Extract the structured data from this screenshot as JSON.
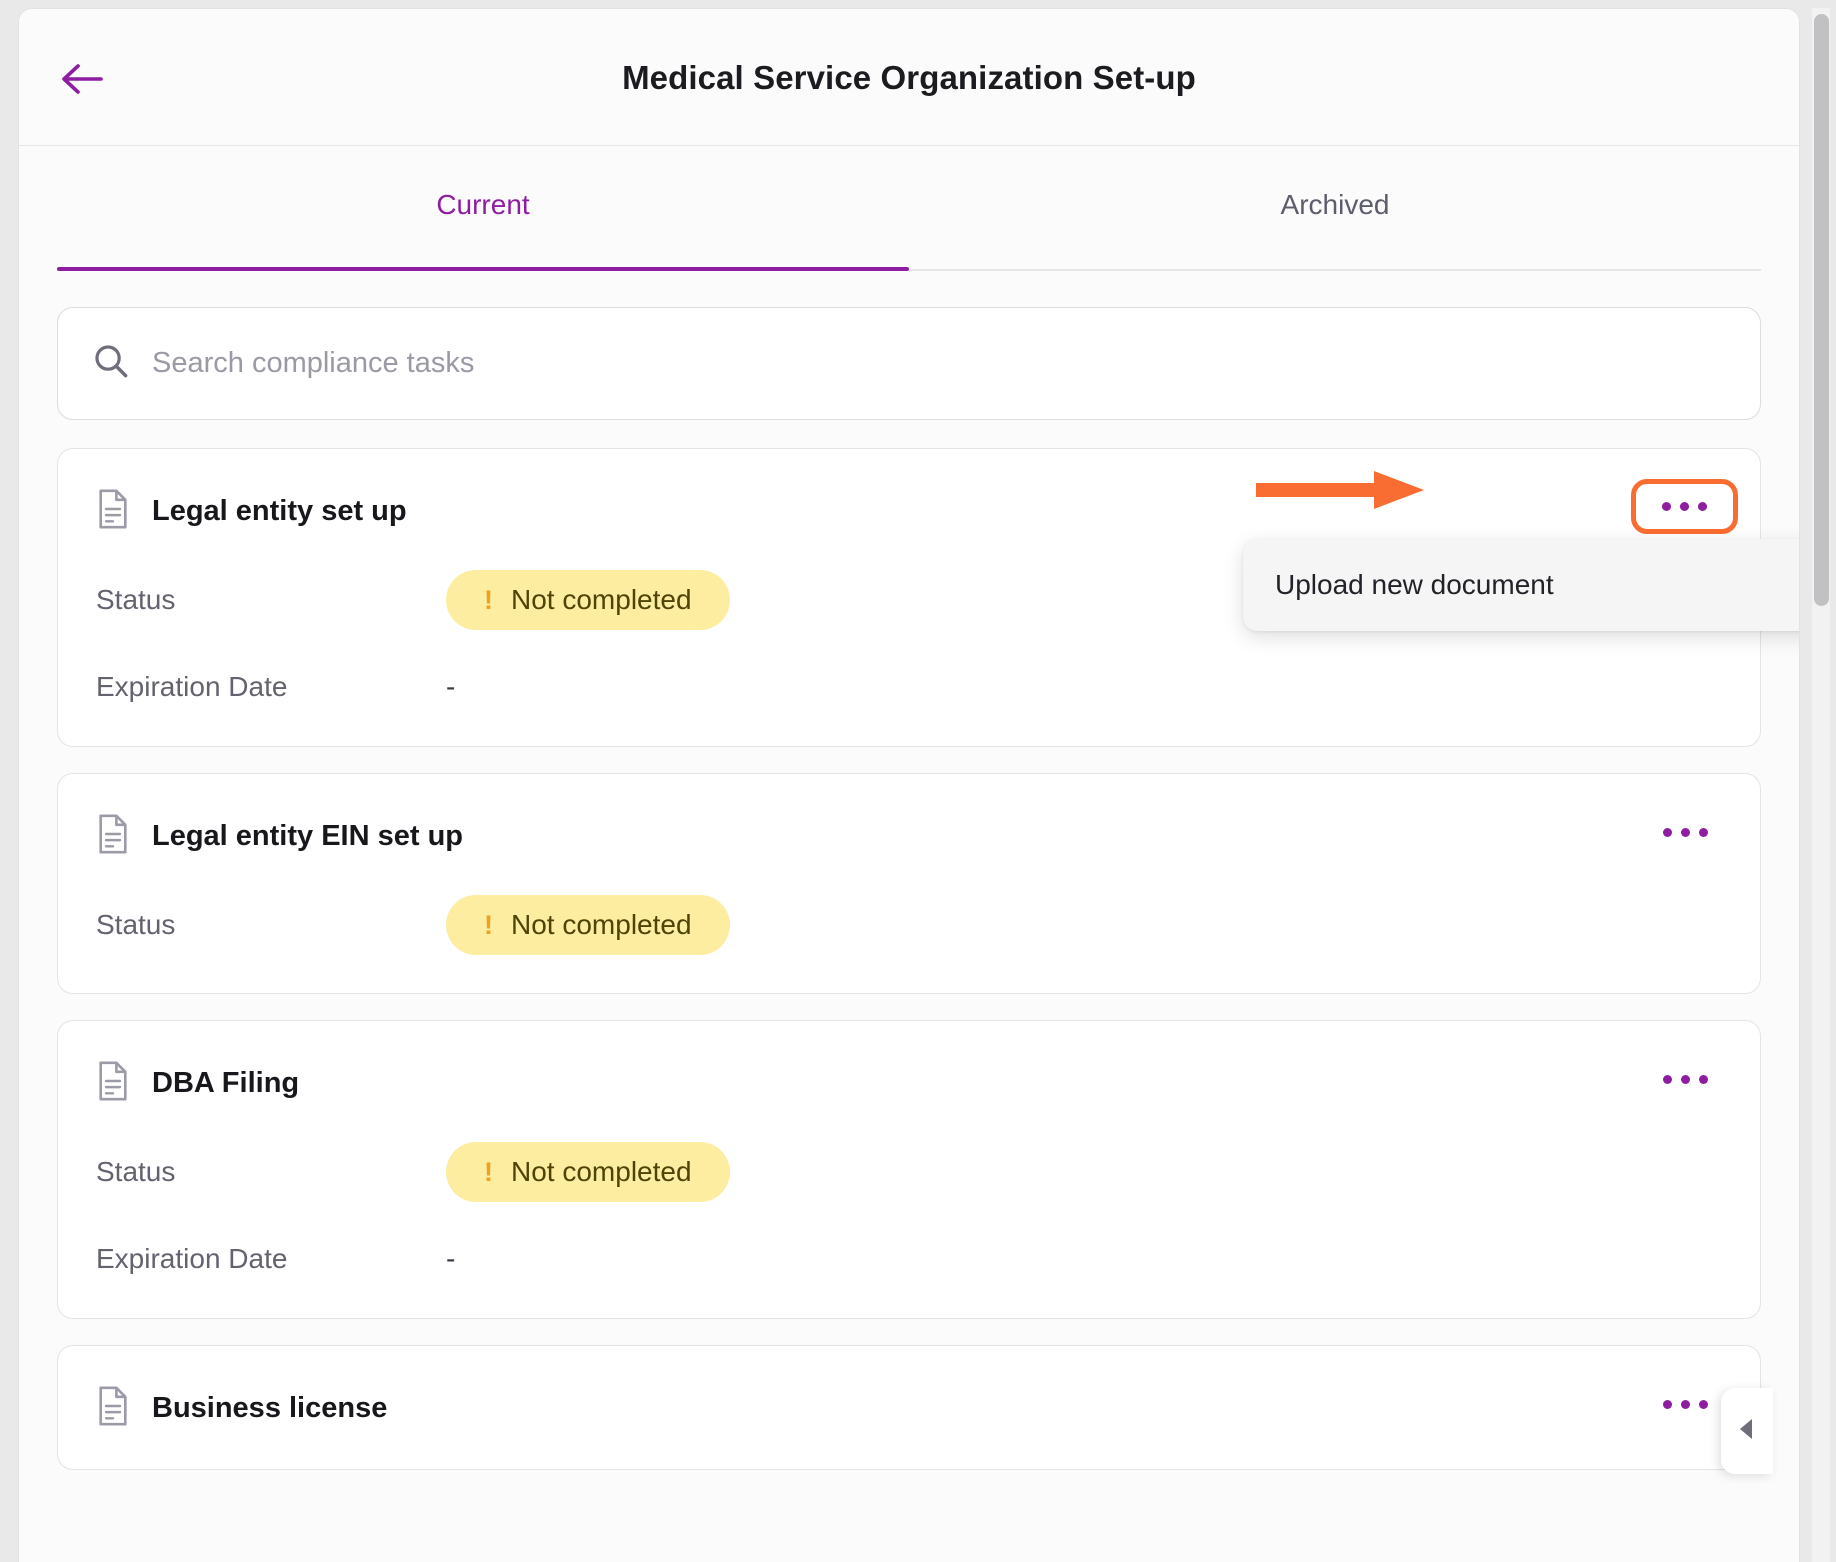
{
  "header": {
    "back_icon": "arrow-left-icon",
    "title": "Medical Service Organization Set-up"
  },
  "tabs": [
    {
      "label": "Current",
      "active": true
    },
    {
      "label": "Archived",
      "active": false
    }
  ],
  "search": {
    "icon": "search-icon",
    "placeholder": "Search compliance tasks",
    "value": ""
  },
  "labels": {
    "status": "Status",
    "expiration_date": "Expiration Date",
    "kebab_icon": "more-options-icon",
    "document_icon": "document-icon",
    "empty_value": "-",
    "badge_bang": "!"
  },
  "tasks": [
    {
      "title": "Legal entity set up",
      "status": "Not completed",
      "expiration_date": "-",
      "has_expiration": true,
      "menu_highlighted": true
    },
    {
      "title": "Legal entity EIN set up",
      "status": "Not completed",
      "expiration_date": "",
      "has_expiration": false,
      "menu_highlighted": false
    },
    {
      "title": "DBA Filing",
      "status": "Not completed",
      "expiration_date": "-",
      "has_expiration": true,
      "menu_highlighted": false
    },
    {
      "title": "Business license",
      "status": "",
      "expiration_date": "",
      "has_expiration": false,
      "menu_highlighted": false
    }
  ],
  "dropdown": {
    "items": [
      {
        "label": "Upload new document"
      }
    ]
  },
  "annotation": {
    "arrow_color": "#fa6d32",
    "highlight_color": "#fa6d32"
  },
  "side_panel": {
    "collapse_icon": "chevron-left-icon"
  },
  "colors": {
    "accent": "#8e1da2",
    "badge_bg": "#fceda1",
    "badge_text": "#4e4406",
    "badge_icon": "#f0a020"
  }
}
